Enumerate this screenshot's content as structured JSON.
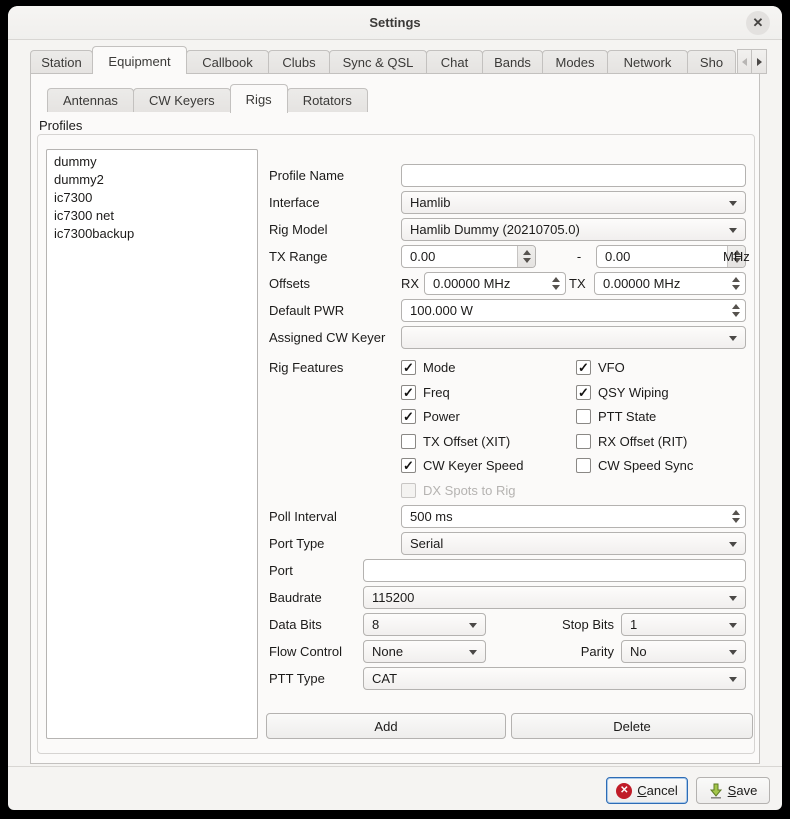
{
  "window": {
    "title": "Settings",
    "close_glyph": "✕"
  },
  "tabs": {
    "items": [
      {
        "label": "Station",
        "active": false
      },
      {
        "label": "Equipment",
        "active": true
      },
      {
        "label": "Callbook",
        "active": false
      },
      {
        "label": "Clubs",
        "active": false
      },
      {
        "label": "Sync & QSL",
        "active": false
      },
      {
        "label": "Chat",
        "active": false
      },
      {
        "label": "Bands",
        "active": false
      },
      {
        "label": "Modes",
        "active": false
      },
      {
        "label": "Network",
        "active": false
      },
      {
        "label": "Sho",
        "active": false
      }
    ]
  },
  "subtabs": {
    "items": [
      {
        "label": "Antennas",
        "active": false
      },
      {
        "label": "CW Keyers",
        "active": false
      },
      {
        "label": "Rigs",
        "active": true
      },
      {
        "label": "Rotators",
        "active": false
      }
    ]
  },
  "profiles": {
    "group_label": "Profiles",
    "list": [
      "dummy",
      "dummy2",
      "ic7300",
      "ic7300 net",
      "ic7300backup"
    ]
  },
  "form": {
    "profile_name": {
      "label": "Profile Name",
      "value": ""
    },
    "interface": {
      "label": "Interface",
      "value": "Hamlib"
    },
    "rig_model": {
      "label": "Rig Model",
      "value": "Hamlib Dummy (20210705.0)"
    },
    "tx_range": {
      "label": "TX Range",
      "from": "0.00",
      "separator": "-",
      "to": "0.00",
      "unit": "MHz"
    },
    "offsets": {
      "label": "Offsets",
      "rx_label": "RX",
      "rx_value": "0.00000 MHz",
      "tx_label": "TX",
      "tx_value": "0.00000 MHz"
    },
    "default_pwr": {
      "label": "Default PWR",
      "value": "100.000 W"
    },
    "assigned_cw_keyer": {
      "label": "Assigned CW Keyer",
      "value": ""
    },
    "rig_features": {
      "label": "Rig Features",
      "check_glyph": "✓",
      "columns": [
        [
          {
            "label": "Mode",
            "checked": true,
            "disabled": false
          },
          {
            "label": "Freq",
            "checked": true,
            "disabled": false
          },
          {
            "label": "Power",
            "checked": true,
            "disabled": false
          },
          {
            "label": "TX Offset (XIT)",
            "checked": false,
            "disabled": false
          },
          {
            "label": "CW Keyer Speed",
            "checked": true,
            "disabled": false
          },
          {
            "label": "DX Spots to Rig",
            "checked": false,
            "disabled": true
          }
        ],
        [
          {
            "label": "VFO",
            "checked": true,
            "disabled": false
          },
          {
            "label": "QSY Wiping",
            "checked": true,
            "disabled": false
          },
          {
            "label": "PTT State",
            "checked": false,
            "disabled": false
          },
          {
            "label": "RX Offset (RIT)",
            "checked": false,
            "disabled": false
          },
          {
            "label": "CW Speed Sync",
            "checked": false,
            "disabled": false
          }
        ]
      ]
    },
    "poll_interval": {
      "label": "Poll Interval",
      "value": "500 ms"
    },
    "port_type": {
      "label": "Port Type",
      "value": "Serial"
    },
    "port": {
      "label": "Port",
      "value": ""
    },
    "baudrate": {
      "label": "Baudrate",
      "value": "115200"
    },
    "data_bits": {
      "label": "Data Bits",
      "value": "8"
    },
    "stop_bits": {
      "label": "Stop Bits",
      "value": "1"
    },
    "flow_control": {
      "label": "Flow Control",
      "value": "None"
    },
    "parity": {
      "label": "Parity",
      "value": "No"
    },
    "ptt_type": {
      "label": "PTT Type",
      "value": "CAT"
    },
    "add_button": "Add",
    "delete_button": "Delete"
  },
  "footer": {
    "cancel": {
      "icon_glyph": "✕",
      "initial": "C",
      "rest": "ancel"
    },
    "save": {
      "initial": "S",
      "rest": "ave"
    }
  }
}
